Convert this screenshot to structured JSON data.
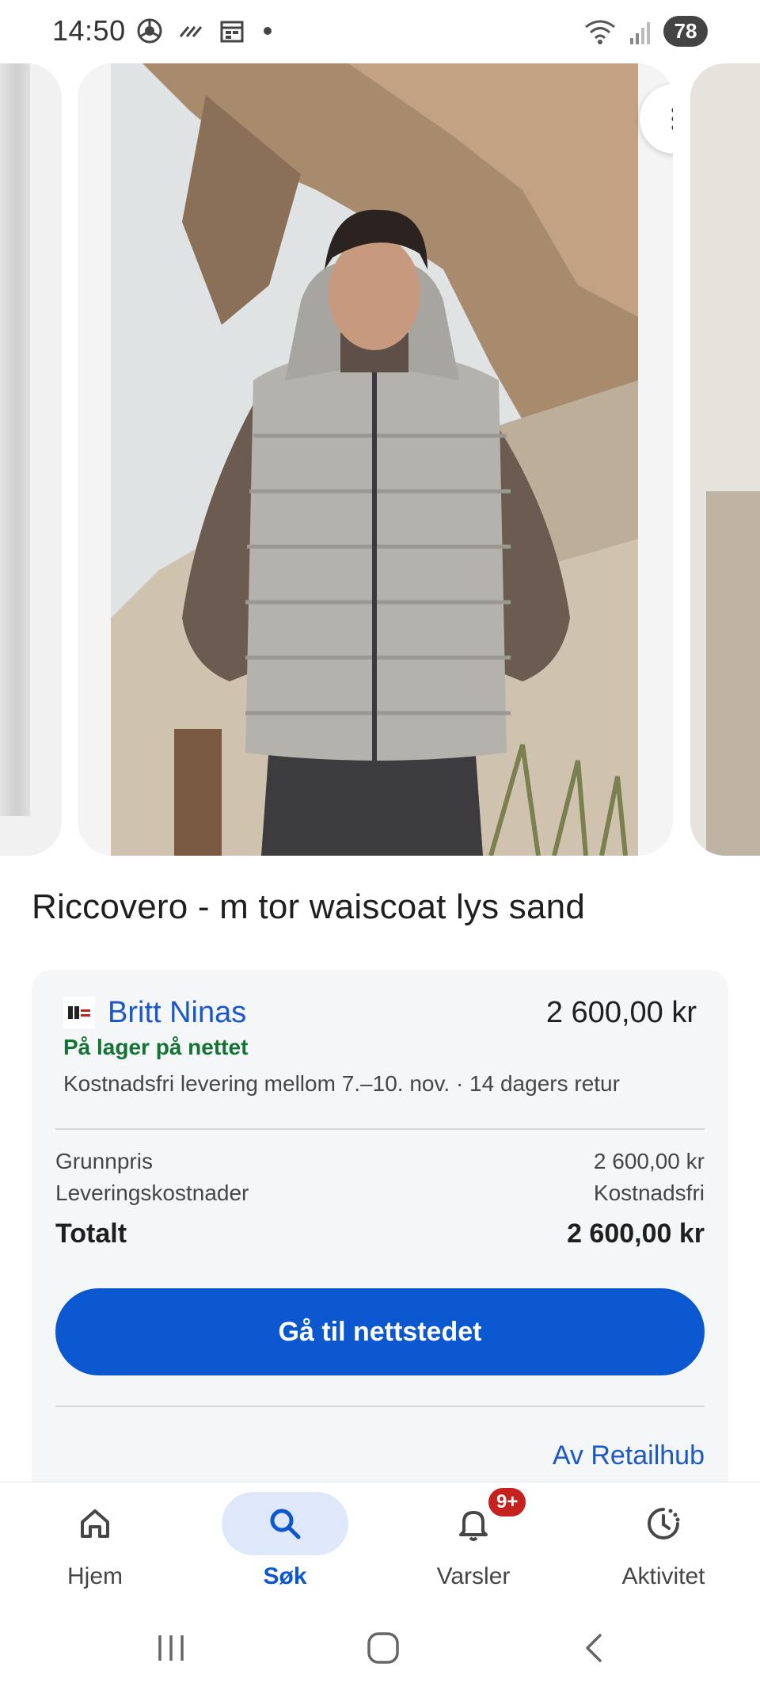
{
  "status_bar": {
    "time": "14:50",
    "battery": "78",
    "icons_left": [
      "chrome-app-icon",
      "cast-icon",
      "calendar-icon",
      "notification-dot-icon"
    ],
    "icons_right": [
      "wifi-icon",
      "signal-icon"
    ]
  },
  "carousel": {
    "buttons": [
      "more-vert-icon",
      "close-icon"
    ]
  },
  "product": {
    "title": "Riccovero - m tor waiscoat lys sand"
  },
  "offer": {
    "seller_name": "Britt Ninas",
    "price": "2 600,00 kr",
    "stock_status": "På lager på nettet",
    "shipping_info": "Kostnadsfri levering mellom 7.–10. nov. · 14 dagers retur",
    "summary": {
      "base_label": "Grunnpris",
      "base_value": "2 600,00 kr",
      "delivery_label": "Leveringskostnader",
      "delivery_value": "Kostnadsfri",
      "total_label": "Totalt",
      "total_value": "2 600,00 kr"
    },
    "cta_label": "Gå til nettstedet",
    "attribution": "Av Retailhub"
  },
  "bottom_nav": {
    "items": [
      {
        "label": "Hjem",
        "icon": "home-icon"
      },
      {
        "label": "Søk",
        "icon": "search-icon",
        "active": true
      },
      {
        "label": "Varsler",
        "icon": "bell-icon",
        "badge": "9+"
      },
      {
        "label": "Aktivitet",
        "icon": "activity-icon"
      }
    ]
  },
  "system_nav": [
    "recents-icon",
    "home-circle-icon",
    "back-icon"
  ],
  "colors": {
    "accent": "#0b57d0",
    "link": "#1a57c9",
    "stock_green": "#137333",
    "badge_red": "#c5221f",
    "panel_bg": "#f5f6f8"
  }
}
